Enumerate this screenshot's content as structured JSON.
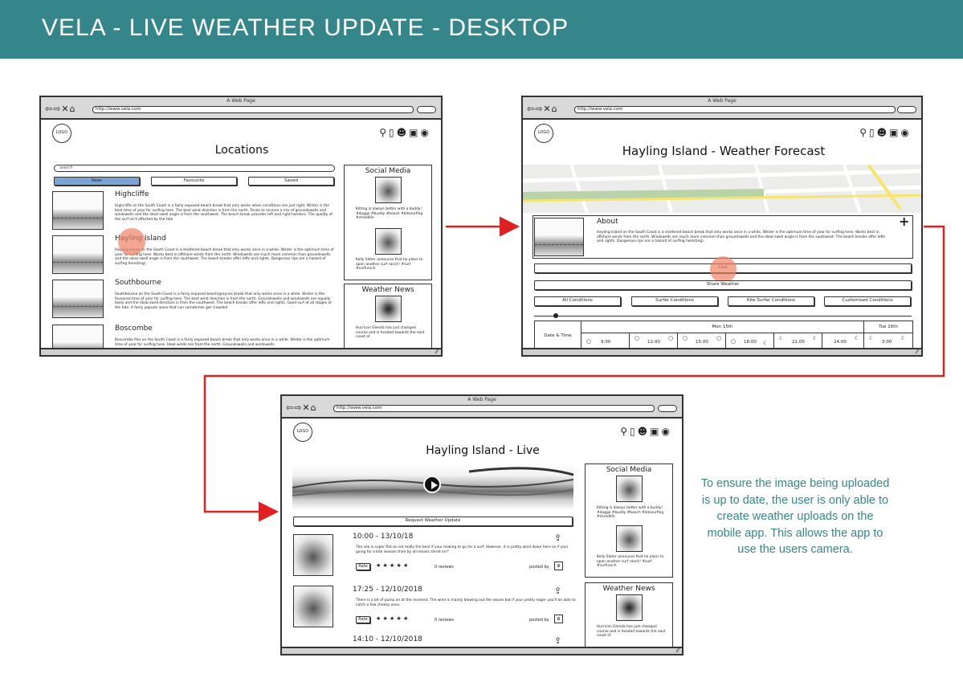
{
  "page": {
    "title": "VELA - LIVE WEATHER UPDATE - DESKTOP"
  },
  "browser": {
    "page_title": "A Web Page",
    "url": "http://www.vela.com",
    "nav_glyphs": "⇦⇨✕⌂"
  },
  "common": {
    "logo": "LOGO",
    "icons": [
      "location-icon",
      "map-icon",
      "group-icon",
      "id-card-icon",
      "user-icon"
    ]
  },
  "locations": {
    "title": "Locations",
    "search_placeholder": "search",
    "tabs": [
      "Near",
      "Favourite",
      "Saved"
    ],
    "items": [
      {
        "name": "Highcliffe",
        "desc": "Highcliffe on the South Coast is a fairly exposed beach break that only works when conditions are just right. Winter is the best time of year for surfing here. The best wind direction is from the north. Tends to receive a mix of groundswells and windswells and the ideal swell angle is from the southwest. The beach break provides left and right handers. The quality of the surf isn't affected by the tide"
      },
      {
        "name": "Hayling Island",
        "desc": "Hayling Island on the South Coast is a sheltered beach break that only works once in a while. Winter is the optimum time of year for surfing here. Works best in offshore winds from the north. Windswells are much more common than groundswells and the ideal swell angle is from the southwest. The beach breaks offer lefts and rights. Dangerous rips are a hazard of surfing here(ting)"
      },
      {
        "name": "Southbourne",
        "desc": "Southbourne on the South Coast is a fairly exposed beach/groynes break that only works once in a while. Winter is the favoured time of year for surfing here. The best wind direction is from the north. Groundswells and windswells are equally likely and the ideal swell direction is from the southwest. The beach breaks offer lefts and rights. Good surf at all stages of the tide. A fairly popular wave that can sometimes get crowded"
      },
      {
        "name": "Boscombe",
        "desc": "Boscombe Pier on the South Coast is a fairly exposed beach break that only works once in a while. Winter is the optimum time of year for surfing here. Ideal winds are from the north. Groundswells and windswells"
      }
    ]
  },
  "social": {
    "title": "Social Media",
    "posts": [
      "Kitting is always better with a buddy! #doggo #buddy #beach #kitesurfing #shredlife",
      "Kelly Slater annouces that he plans to open another surf ranch! #surf #surfranch"
    ]
  },
  "weather_news": {
    "title": "Weather News",
    "text": "Hurrican Glenda has just changed course and is headed towards the east coast of"
  },
  "forecast": {
    "title": "Hayling Island - Weather Forecast",
    "about_title": "About",
    "about_text": "Hayling Island on the South Coast is a sheltered beach break that only works once in a while. Winter is the optimum time of year for surfing here. Works best in offshore winds from the north. Windswells are much more common than groundswells and the ideal swell angle is from the southwest. The beach breaks offer lefts and rights. Dangerous rips are a hazard of surfing here(ting)",
    "add_glyph": "+",
    "live_label": "Live",
    "share_label": "Share Weather",
    "condition_tabs": [
      "All Conditions",
      "Surfer Conditions",
      "Kite Surfer Conditions",
      "Customised Conditions"
    ],
    "date_time_label": "Date & Time",
    "day1": "Mon 15th",
    "day2": "Tue 16th",
    "times": [
      "9:00",
      "12:00",
      "15:00",
      "18:00",
      "21:00",
      "24:00",
      "3:00"
    ]
  },
  "live": {
    "title": "Hayling Island - Live",
    "request_label": "Request Weather Update",
    "rate_label": "Rate",
    "reviews_label": "0 reviews",
    "posted_by_label": "posted by",
    "stars": "★ ★ ★ ★ ★",
    "updates": [
      {
        "time": "10:00 - 13/10/18",
        "text": "The sea is super flat so not really the best if your looking to go for a surf. However, it is pretty wind down here so if your going for a kite session then by all means shred on!!"
      },
      {
        "time": "17:25 - 12/10/2018",
        "text": "There is a bit of pump on at the moment. The wind is mainly blowing out the waves but if your pretty eager you'll be able to catch a few cheeky ones."
      },
      {
        "time": "14:10 - 12/10/2018",
        "text": ""
      }
    ]
  },
  "note": "To  ensure the image being uploaded is up to date, the user is only able to create weather uploads on the mobile app. This allows the app to use the users camera.",
  "colors": {
    "header": "#35868a",
    "arrow": "#e02020",
    "highlight": "#ee8264",
    "active_tab": "#7aa4d4"
  }
}
